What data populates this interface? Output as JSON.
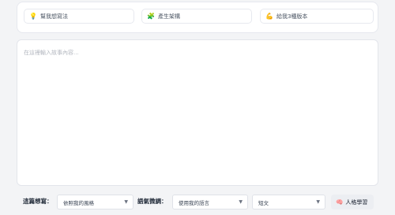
{
  "suggestions": [
    {
      "icon": "lightbulb-icon",
      "glyph": "💡",
      "label": "幫我想寫法"
    },
    {
      "icon": "puzzle-icon",
      "glyph": "🧩",
      "label": "產生架構"
    },
    {
      "icon": "muscle-icon",
      "glyph": "💪",
      "label": "給我3種版本"
    }
  ],
  "editor": {
    "placeholder": "在這裡輸入故事內容..."
  },
  "toolbar": {
    "idea_label": "這篇想寫：",
    "idea_value": "依照我的風格",
    "tone_label": "語氣微調：",
    "tone_value": "使用我的語言",
    "length_value": "短文",
    "persona_button": "人格學習",
    "persona_icon": "brain-icon",
    "persona_glyph": "🧠"
  }
}
